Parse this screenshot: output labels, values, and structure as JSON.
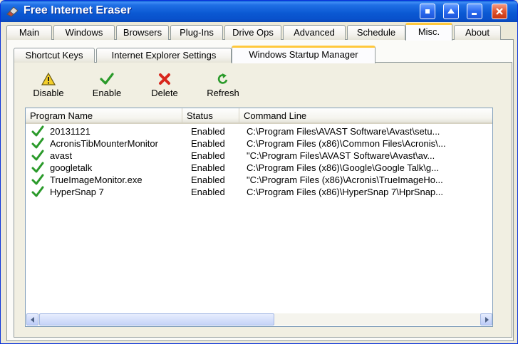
{
  "window": {
    "title": "Free Internet Eraser"
  },
  "main_tabs": [
    {
      "label": "Main"
    },
    {
      "label": "Windows"
    },
    {
      "label": "Browsers"
    },
    {
      "label": "Plug-Ins"
    },
    {
      "label": "Drive Ops"
    },
    {
      "label": "Advanced"
    },
    {
      "label": "Schedule"
    },
    {
      "label": "Misc.",
      "active": true
    },
    {
      "label": "About"
    }
  ],
  "sub_tabs": [
    {
      "label": "Shortcut Keys"
    },
    {
      "label": "Internet Explorer Settings"
    },
    {
      "label": "Windows Startup Manager",
      "active": true
    }
  ],
  "toolbar": {
    "disable_label": "Disable",
    "enable_label": "Enable",
    "delete_label": "Delete",
    "refresh_label": "Refresh"
  },
  "list": {
    "columns": [
      "Program Name",
      "Status",
      "Command Line"
    ],
    "rows": [
      {
        "name": "20131121",
        "status": "Enabled",
        "command": "C:\\Program Files\\AVAST Software\\Avast\\setu..."
      },
      {
        "name": "AcronisTibMounterMonitor",
        "status": "Enabled",
        "command": "C:\\Program Files (x86)\\Common Files\\Acronis\\..."
      },
      {
        "name": "avast",
        "status": "Enabled",
        "command": "\"C:\\Program Files\\AVAST Software\\Avast\\av..."
      },
      {
        "name": "googletalk",
        "status": "Enabled",
        "command": "C:\\Program Files (x86)\\Google\\Google Talk\\g..."
      },
      {
        "name": "TrueImageMonitor.exe",
        "status": "Enabled",
        "command": "\"C:\\Program Files (x86)\\Acronis\\TrueImageHo..."
      },
      {
        "name": "HyperSnap 7",
        "status": "Enabled",
        "command": "C:\\Program Files (x86)\\HyperSnap 7\\HprSnap..."
      }
    ]
  },
  "icons": {
    "disable": "warning-icon",
    "enable": "checkmark-icon",
    "delete": "red-x-icon",
    "refresh": "refresh-icon",
    "row": "checkmark-icon"
  },
  "colors": {
    "titlebar": "#0a58d2",
    "active_tab_accent": "#ffc83c",
    "check_green": "#2a9a2a",
    "delete_red": "#d8261c"
  }
}
